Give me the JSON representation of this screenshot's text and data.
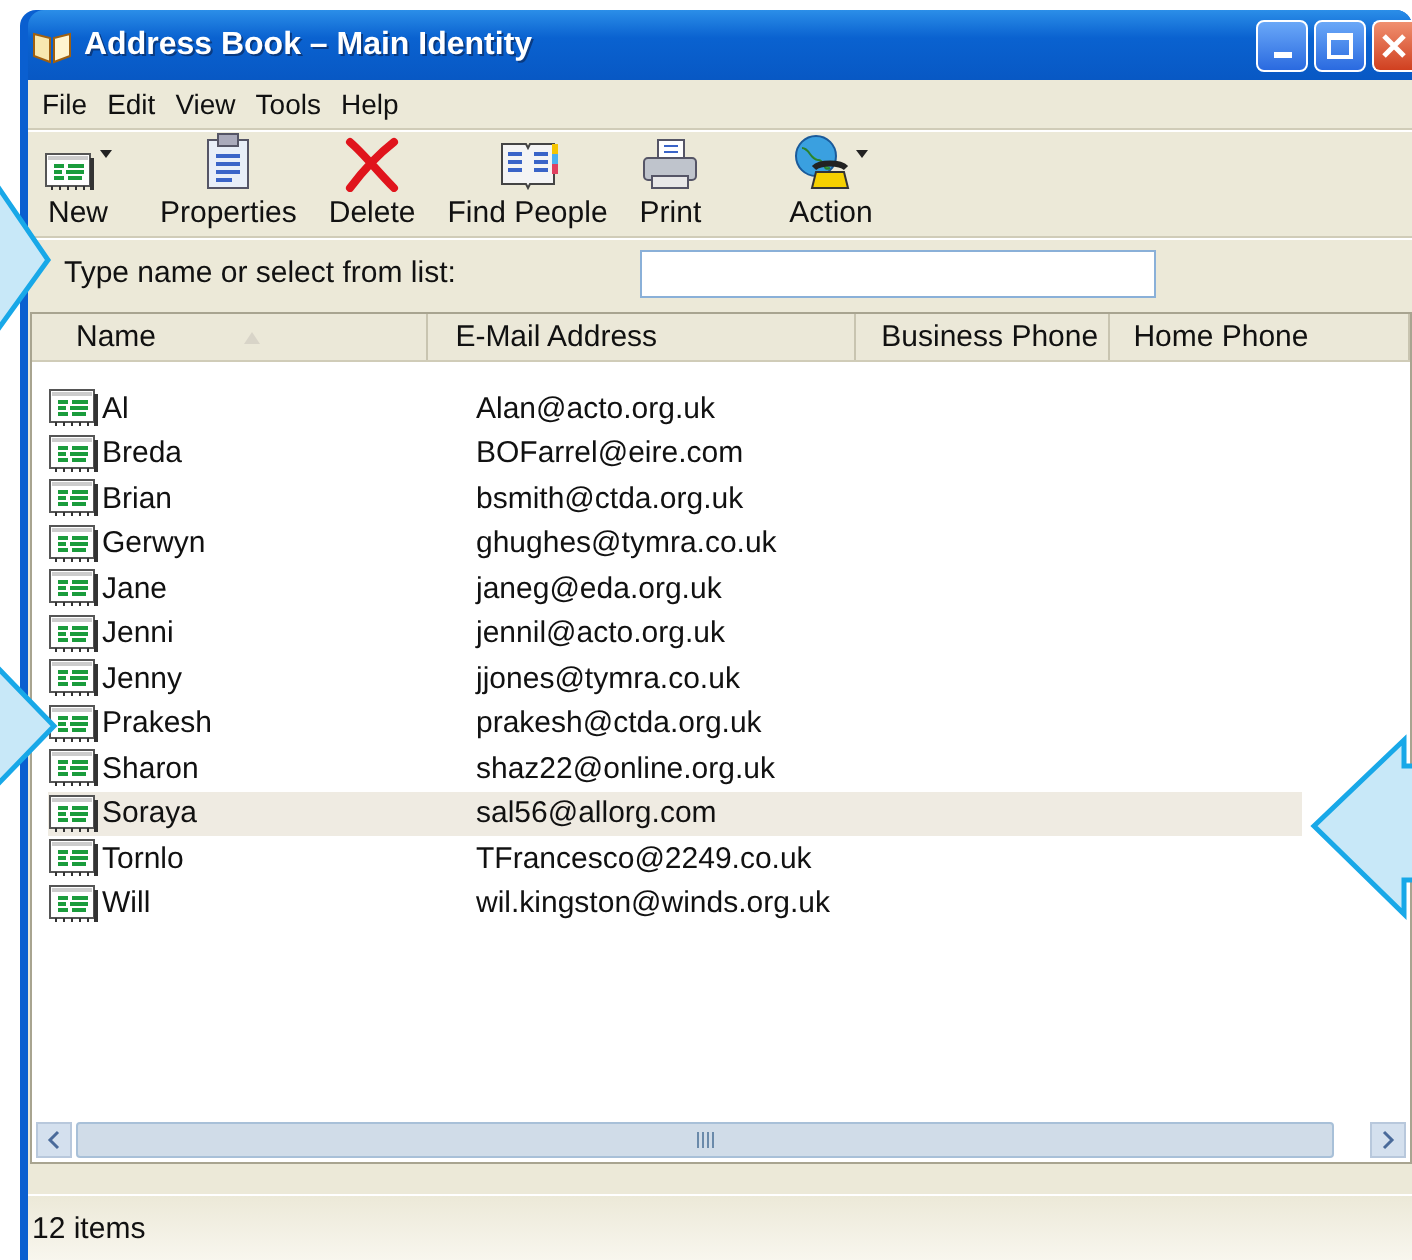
{
  "window": {
    "title": "Address Book – Main Identity"
  },
  "menu": [
    "File",
    "Edit",
    "View",
    "Tools",
    "Help"
  ],
  "toolbar": [
    {
      "label": "New",
      "kind": "new",
      "dropdown": true
    },
    {
      "label": "Properties",
      "kind": "properties",
      "dropdown": false
    },
    {
      "label": "Delete",
      "kind": "delete",
      "dropdown": false
    },
    {
      "label": "Find People",
      "kind": "find",
      "dropdown": false
    },
    {
      "label": "Print",
      "kind": "print",
      "dropdown": false
    },
    {
      "label": "Action",
      "kind": "action",
      "dropdown": true
    }
  ],
  "search": {
    "label": "Type name or select from list:"
  },
  "table": {
    "columns": [
      {
        "label": "Name",
        "sorted": true
      },
      {
        "label": "E-Mail Address",
        "sorted": false
      },
      {
        "label": "Business Phone",
        "sorted": false
      },
      {
        "label": "Home Phone",
        "sorted": false
      }
    ],
    "rows": [
      {
        "name": "Al",
        "email": "Alan@acto.org.uk",
        "selected": false
      },
      {
        "name": "Breda",
        "email": "BOFarrel@eire.com",
        "selected": false
      },
      {
        "name": "Brian",
        "email": "bsmith@ctda.org.uk",
        "selected": false
      },
      {
        "name": "Gerwyn",
        "email": "ghughes@tymra.co.uk",
        "selected": false
      },
      {
        "name": "Jane",
        "email": "janeg@eda.org.uk",
        "selected": false
      },
      {
        "name": "Jenni",
        "email": "jennil@acto.org.uk",
        "selected": false
      },
      {
        "name": "Jenny",
        "email": "jjones@tymra.co.uk",
        "selected": false
      },
      {
        "name": "Prakesh",
        "email": "prakesh@ctda.org.uk",
        "selected": false
      },
      {
        "name": "Sharon",
        "email": "shaz22@online.org.uk",
        "selected": false
      },
      {
        "name": "Soraya",
        "email": "sal56@allorg.com",
        "selected": true
      },
      {
        "name": "Tornlo",
        "email": "TFrancesco@2249.co.uk",
        "selected": false
      },
      {
        "name": "Will",
        "email": "wil.kingston@winds.org.uk",
        "selected": false
      }
    ]
  },
  "status_bar": {
    "text": "12 items"
  }
}
